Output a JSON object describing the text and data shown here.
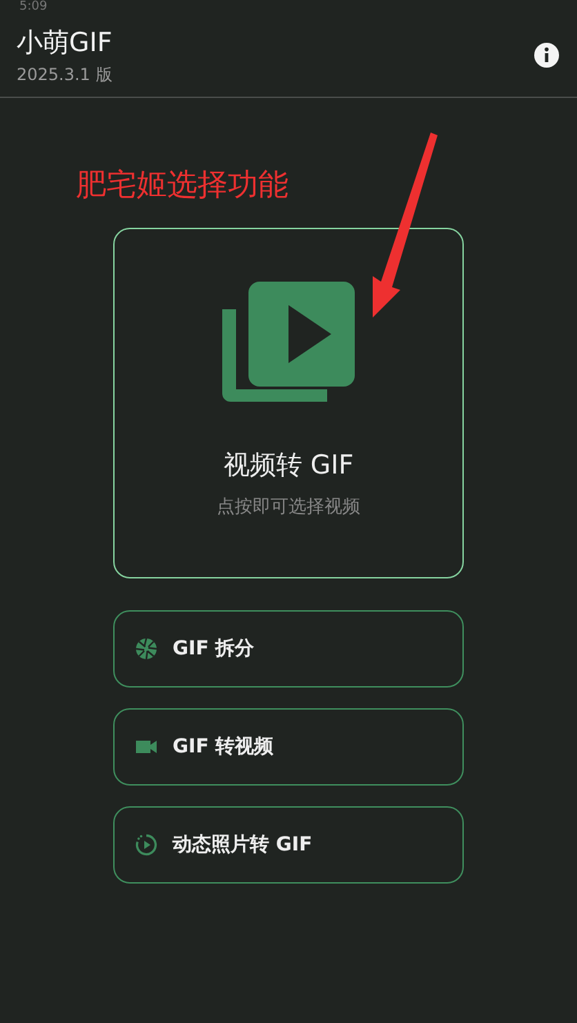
{
  "status_bar": {
    "time": "5:09"
  },
  "app_bar": {
    "title": "小萌GIF",
    "subtitle": "2025.3.1 版"
  },
  "annotation": {
    "text": "肥宅姬选择功能"
  },
  "main_card": {
    "title": "视频转 GIF",
    "hint": "点按即可选择视频"
  },
  "actions": [
    {
      "kind": "aperture",
      "label": "GIF 拆分"
    },
    {
      "kind": "videocam",
      "label": "GIF 转视频"
    },
    {
      "kind": "motion",
      "label": "动态照片转 GIF"
    }
  ]
}
